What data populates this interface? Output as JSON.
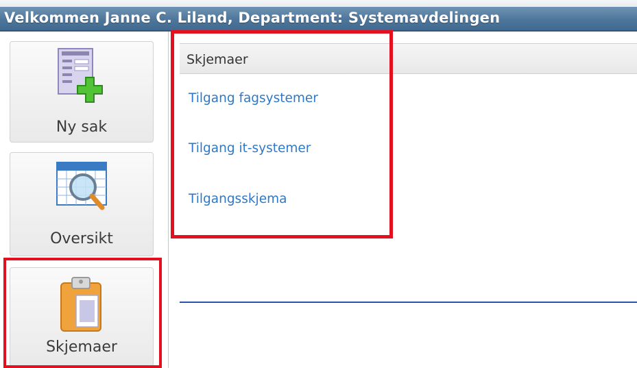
{
  "header": {
    "title": "Velkommen Janne C. Liland, Department: Systemavdelingen"
  },
  "sidebar": {
    "items": [
      {
        "label": "Ny sak",
        "icon": "new-case-icon"
      },
      {
        "label": "Oversikt",
        "icon": "calendar-search-icon"
      },
      {
        "label": "Skjemaer",
        "icon": "clipboard-icon"
      }
    ]
  },
  "main": {
    "panel_title": "Skjemaer",
    "links": [
      {
        "label": "Tilgang fagsystemer"
      },
      {
        "label": "Tilgang it-systemer"
      },
      {
        "label": "Tilgangsskjema"
      }
    ]
  },
  "colors": {
    "header_bg": "#4e769b",
    "link": "#2e78c7",
    "highlight": "#e3111f",
    "divider": "#2a50a8"
  }
}
